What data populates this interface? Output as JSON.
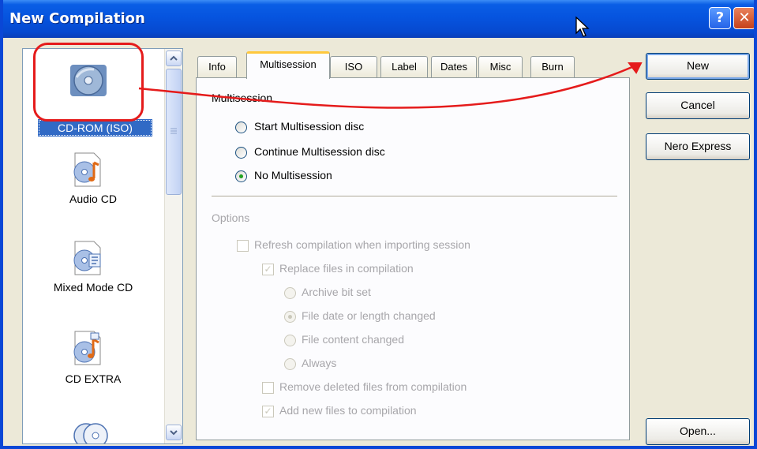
{
  "window": {
    "title": "New Compilation",
    "help_glyph": "?",
    "close_glyph": "✕"
  },
  "compilation_types": [
    {
      "label": "CD-ROM (ISO)",
      "icon": "cdrom-iso-icon",
      "selected": true
    },
    {
      "label": "Audio CD",
      "icon": "audio-cd-icon"
    },
    {
      "label": "Mixed Mode CD",
      "icon": "mixed-mode-cd-icon"
    },
    {
      "label": "CD EXTRA",
      "icon": "cd-extra-icon"
    }
  ],
  "tabs": [
    "Info",
    "Multisession",
    "ISO",
    "Label",
    "Dates",
    "Misc",
    "Burn"
  ],
  "active_tab": "Multisession",
  "multisession": {
    "heading": "Multisession",
    "options": [
      "Start Multisession disc",
      "Continue Multisession disc",
      "No Multisession"
    ],
    "selected": "No Multisession"
  },
  "options": {
    "heading": "Options",
    "refresh": "Refresh compilation when importing session",
    "replace": "Replace files in compilation",
    "archive": "Archive bit set",
    "date_changed": "File date or length changed",
    "content_changed": "File content changed",
    "always": "Always",
    "remove_deleted": "Remove deleted files from compilation",
    "add_new": "Add new files to compilation",
    "check_glyph": "✓"
  },
  "buttons": {
    "new": "New",
    "cancel": "Cancel",
    "nero_express": "Nero Express",
    "open": "Open..."
  },
  "colors": {
    "titlebar": "#0a5ee5",
    "selection": "#316ac5",
    "annotation": "#e51b1b"
  }
}
